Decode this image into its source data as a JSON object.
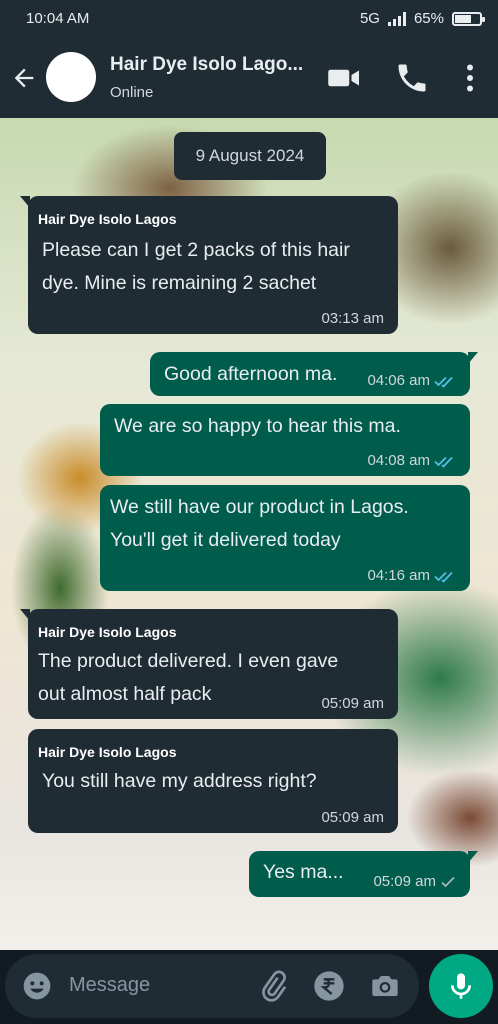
{
  "status_bar": {
    "time": "10:04 AM",
    "network": "5G",
    "battery": "65%",
    "battery_level": 0.65
  },
  "header": {
    "contact_name": "Hair Dye Isolo Lago...",
    "status": "Online"
  },
  "chat": {
    "date": "9 August 2024",
    "messages": [
      {
        "direction": "in",
        "sender": "Hair Dye Isolo Lagos",
        "lines": [
          " Please can I get 2 packs of this hair",
          "dye. Mine is remaining 2 sachet"
        ],
        "time": "03:13 am"
      },
      {
        "direction": "out",
        "lines": [
          "Good afternoon ma."
        ],
        "time": "04:06 am",
        "ticks": "double-read"
      },
      {
        "direction": "out",
        "lines": [
          "We are so happy to hear this ma."
        ],
        "time": "04:08 am",
        "ticks": "double-read"
      },
      {
        "direction": "out",
        "lines": [
          "We still have our product in Lagos.",
          "You'll get it delivered today"
        ],
        "time": "04:16 am",
        "ticks": "double-read"
      },
      {
        "direction": "in",
        "sender": "Hair Dye Isolo Lagos",
        "lines": [
          " The product delivered. I even gave",
          "out almost half pack"
        ],
        "time": "05:09 am"
      },
      {
        "direction": "in",
        "sender": "Hair Dye Isolo Lagos",
        "lines": [
          "You still have my address right?"
        ],
        "time": "05:09 am"
      },
      {
        "direction": "out",
        "lines": [
          "Yes ma..."
        ],
        "time": "05:09 am",
        "ticks": "single-sent"
      }
    ]
  },
  "input": {
    "placeholder": "Message"
  },
  "colors": {
    "incoming_bubble": "#202c33",
    "outgoing_bubble": "#005c4b",
    "read_tick": "#53bdeb",
    "mic_button": "#00a884"
  }
}
